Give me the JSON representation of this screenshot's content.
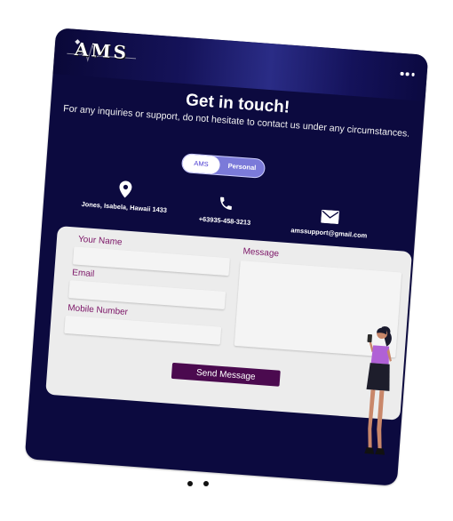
{
  "header": {
    "logo_text": "AMS",
    "more_icon": "more-horizontal-icon"
  },
  "hero": {
    "title": "Get in touch!",
    "subtitle": "For any inquiries or support, do not hesitate to contact us under any circumstances."
  },
  "toggle": {
    "option_1": "AMS",
    "option_2": "Personal",
    "selected": "AMS"
  },
  "contacts": {
    "location": {
      "icon": "location-pin-icon",
      "text": "Jones, Isabela, Hawaii 1433"
    },
    "phone": {
      "icon": "phone-icon",
      "text": "+63935-458-3213"
    },
    "email": {
      "icon": "envelope-icon",
      "text": "amssupport@gmail.com"
    }
  },
  "form": {
    "name_label": "Your Name",
    "name_value": "",
    "email_label": "Email",
    "email_value": "",
    "mobile_label": "Mobile Number",
    "mobile_value": "",
    "message_label": "Message",
    "message_value": "",
    "submit_label": "Send Message"
  },
  "carousel": {
    "page_count": 2
  },
  "colors": {
    "card_bg": "#0c0a3f",
    "label_color": "#7b1466",
    "button_bg": "#4b0a4f",
    "toggle_bg": "#7b7ad9",
    "panel_bg": "#ececec"
  }
}
